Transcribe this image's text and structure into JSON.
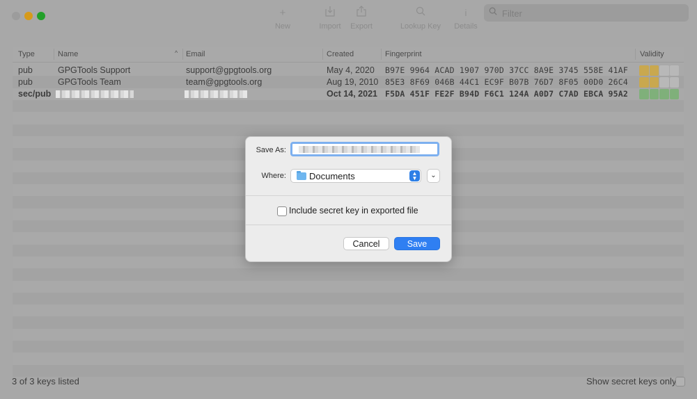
{
  "toolbar": {
    "new": {
      "icon": "plus-icon",
      "label": "New"
    },
    "import": {
      "icon": "import-icon",
      "label": "Import"
    },
    "export": {
      "icon": "export-icon",
      "label": "Export"
    },
    "lookup": {
      "icon": "search-icon",
      "label": "Lookup Key"
    },
    "details": {
      "icon": "info-icon",
      "label": "Details"
    },
    "search_placeholder": "Filter"
  },
  "table": {
    "headers": [
      "Type",
      "Name",
      "Email",
      "Created",
      "Fingerprint",
      "Validity"
    ],
    "rows": [
      {
        "type": "pub",
        "name": "GPGTools Support",
        "email": "support@gpgtools.org",
        "created": "May 4, 2020",
        "fingerprint": "B97E 9964 ACAD 1907 970D  37CC 8A9E 3745 558E 41AF",
        "validity": "2 of 4",
        "validity_color": "#c9a84f"
      },
      {
        "type": "pub",
        "name": "GPGTools Team",
        "email": "team@gpgtools.org",
        "created": "Aug 19, 2010",
        "fingerprint": "85E3 8F69 046B 44C1 EC9F  B07B 76D7 8F05 00D0 26C4",
        "validity": "2 of 4",
        "validity_color": "#c9a84f"
      },
      {
        "type": "sec/pub",
        "name": "",
        "email": "",
        "created": "Oct 14, 2021",
        "fingerprint": "F5DA 451F FE2F B94D F6C1  124A A0D7 C7AD EBCA 95A2",
        "validity": "4 of 4",
        "validity_color": "#7fb07a"
      }
    ]
  },
  "status": {
    "count": "3 of 3 keys listed",
    "secret_only": "Show secret keys only"
  },
  "dialog": {
    "save_as_label": "Save As:",
    "where_label": "Where:",
    "where_value": "Documents",
    "include_secret_label": "Include secret key in exported file",
    "include_secret_checked": false,
    "cancel": "Cancel",
    "save": "Save"
  }
}
